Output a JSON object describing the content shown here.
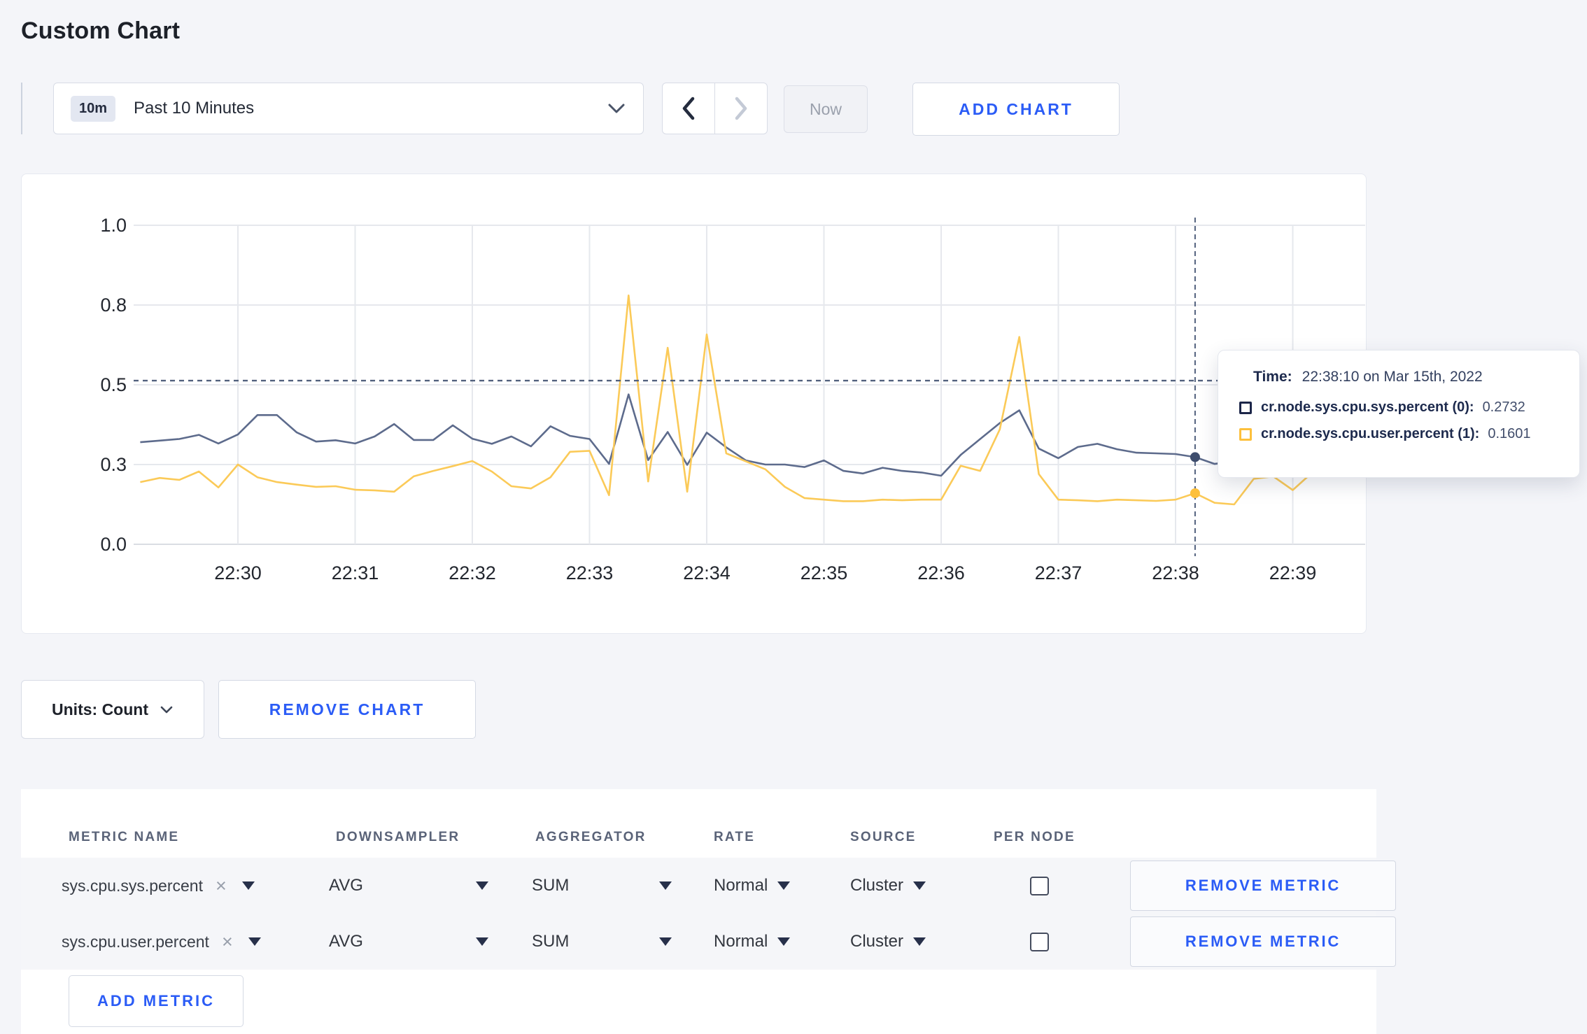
{
  "page": {
    "title": "Custom Chart"
  },
  "icons": {
    "clear": "×"
  },
  "colors": {
    "accent_blue": "#2b5cf6",
    "sys_line": "#5d6b8c",
    "user_line": "#fbca58",
    "sys_swatch": "#1c2649",
    "user_swatch": "#fdc03c",
    "gridline": "#e6e8ed",
    "crosshair": "#53627e"
  },
  "toolbar": {
    "time_range": {
      "badge": "10m",
      "label": "Past 10 Minutes"
    },
    "now_label": "Now",
    "add_chart_label": "ADD CHART"
  },
  "tooltip": {
    "time_label": "Time:",
    "time_value": "22:38:10 on Mar 15th, 2022",
    "rows": [
      {
        "label": "cr.node.sys.cpu.sys.percent (0):",
        "value": "0.2732",
        "color": "#1c2649"
      },
      {
        "label": "cr.node.sys.cpu.user.percent (1):",
        "value": "0.1601",
        "color": "#fdc03c"
      }
    ]
  },
  "units_bar": {
    "units_label": "Units: Count",
    "remove_chart_label": "REMOVE CHART"
  },
  "metrics_table": {
    "columns": [
      "METRIC NAME",
      "DOWNSAMPLER",
      "AGGREGATOR",
      "RATE",
      "SOURCE",
      "PER NODE"
    ],
    "rows": [
      {
        "metric": "sys.cpu.sys.percent",
        "downsampler": "AVG",
        "aggregator": "SUM",
        "rate": "Normal",
        "source": "Cluster",
        "per_node_checked": false,
        "remove_label": "REMOVE METRIC"
      },
      {
        "metric": "sys.cpu.user.percent",
        "downsampler": "AVG",
        "aggregator": "SUM",
        "rate": "Normal",
        "source": "Cluster",
        "per_node_checked": false,
        "remove_label": "REMOVE METRIC"
      }
    ],
    "add_metric_label": "ADD METRIC"
  },
  "chart_data": {
    "type": "line",
    "title": "",
    "x_tick_labels": [
      "22:30",
      "22:31",
      "22:32",
      "22:33",
      "22:34",
      "22:35",
      "22:36",
      "22:37",
      "22:38",
      "22:39"
    ],
    "y_tick_labels": [
      "0.0",
      "0.3",
      "0.5",
      "0.8",
      "1.0"
    ],
    "y_tick_values": [
      0,
      0.25,
      0.5,
      0.75,
      1.0
    ],
    "ylim": [
      0,
      1.0
    ],
    "x_start_time": "22:29:10",
    "x_interval_seconds": 10,
    "series": [
      {
        "name": "cr.node.sys.cpu.sys.percent",
        "values": [
          0.32,
          0.325,
          0.33,
          0.343,
          0.316,
          0.344,
          0.405,
          0.405,
          0.351,
          0.322,
          0.326,
          0.316,
          0.338,
          0.377,
          0.327,
          0.327,
          0.373,
          0.331,
          0.315,
          0.338,
          0.307,
          0.37,
          0.34,
          0.33,
          0.252,
          0.47,
          0.264,
          0.352,
          0.249,
          0.35,
          0.304,
          0.263,
          0.25,
          0.25,
          0.242,
          0.263,
          0.23,
          0.222,
          0.24,
          0.23,
          0.225,
          0.215,
          0.28,
          0.33,
          0.38,
          0.42,
          0.3,
          0.27,
          0.305,
          0.315,
          0.298,
          0.287,
          0.285,
          0.283,
          0.2732,
          0.252,
          0.26,
          0.27,
          0.29,
          0.285,
          0.29,
          0.3,
          0.305
        ]
      },
      {
        "name": "cr.node.sys.cpu.user.percent",
        "values": [
          0.195,
          0.208,
          0.202,
          0.228,
          0.178,
          0.25,
          0.21,
          0.195,
          0.187,
          0.18,
          0.182,
          0.171,
          0.169,
          0.165,
          0.213,
          0.23,
          0.245,
          0.261,
          0.228,
          0.182,
          0.175,
          0.21,
          0.29,
          0.293,
          0.154,
          0.78,
          0.197,
          0.616,
          0.165,
          0.658,
          0.285,
          0.26,
          0.235,
          0.18,
          0.145,
          0.14,
          0.135,
          0.135,
          0.14,
          0.138,
          0.14,
          0.14,
          0.246,
          0.23,
          0.36,
          0.65,
          0.22,
          0.14,
          0.138,
          0.135,
          0.14,
          0.138,
          0.136,
          0.14,
          0.1601,
          0.13,
          0.125,
          0.205,
          0.213,
          0.17,
          0.225,
          0.265,
          0.255
        ]
      }
    ],
    "crosshair": {
      "time": "22:38:10",
      "offset_seconds_from_2230": 490,
      "hover_y_value": 0.513,
      "sys_value": 0.2732,
      "user_value": 0.1601
    },
    "legend_position": "tooltip",
    "grid": true
  }
}
